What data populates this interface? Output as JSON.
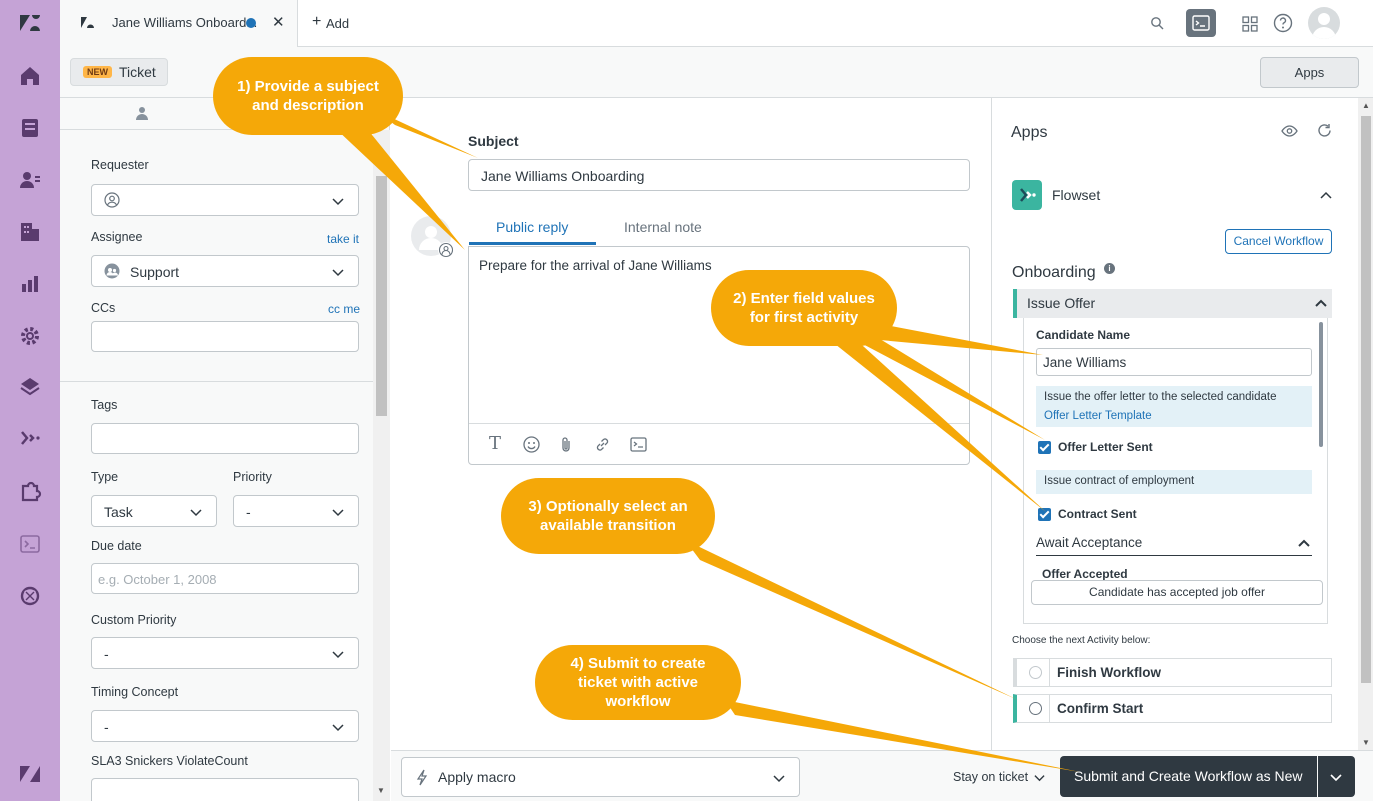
{
  "tabs": {
    "ticket_tab_title": "Jane Williams Onboard...",
    "add_label": "Add"
  },
  "subheader": {
    "new_badge": "NEW",
    "ticket_label": "Ticket",
    "apps_button": "Apps"
  },
  "left_panel": {
    "requester_label": "Requester",
    "assignee_label": "Assignee",
    "take_it": "take it",
    "assignee_value": "Support",
    "ccs_label": "CCs",
    "cc_me": "cc me",
    "tags_label": "Tags",
    "type_label": "Type",
    "type_value": "Task",
    "priority_label": "Priority",
    "priority_value": "-",
    "due_date_label": "Due date",
    "due_date_placeholder": "e.g. October 1, 2008",
    "custom_priority_label": "Custom Priority",
    "custom_priority_value": "-",
    "timing_concept_label": "Timing Concept",
    "timing_concept_value": "-",
    "sla_label": "SLA3 Snickers ViolateCount"
  },
  "center": {
    "subject_label": "Subject",
    "subject_value": "Jane Williams Onboarding",
    "tab_public": "Public reply",
    "tab_internal": "Internal note",
    "body_text": "Prepare for the arrival of Jane Williams"
  },
  "apps": {
    "title": "Apps",
    "app_name": "Flowset",
    "cancel_workflow": "Cancel Workflow",
    "workflow_title": "Onboarding",
    "activity_title": "Issue Offer",
    "candidate_name_label": "Candidate Name",
    "candidate_name_value": "Jane Williams",
    "instruction1": "Issue the offer letter to the selected candidate",
    "instruction1_link": "Offer Letter Template",
    "offer_letter_sent": "Offer Letter Sent",
    "instruction2": "Issue contract of employment",
    "contract_sent": "Contract Sent",
    "await_title": "Await Acceptance",
    "offer_accepted_label": "Offer Accepted",
    "offer_accepted_button": "Candidate has accepted job offer",
    "choose_next": "Choose the next Activity below:",
    "transitions": [
      "Finish Workflow",
      "Confirm Start"
    ]
  },
  "footer": {
    "apply_macro": "Apply macro",
    "stay_on_ticket": "Stay on ticket",
    "submit": "Submit and Create Workflow as New"
  },
  "callouts": {
    "c1": "1) Provide a subject and description",
    "c2": "2) Enter field values for first activity",
    "c3": "3) Optionally select an available transition",
    "c4": "4) Submit to create ticket with active workflow"
  },
  "colors": {
    "nav": "#c5a3d6",
    "accent": "#1f73b7",
    "callout": "#f5a808",
    "flowset": "#3bb5a0",
    "submit": "#2f3941"
  }
}
